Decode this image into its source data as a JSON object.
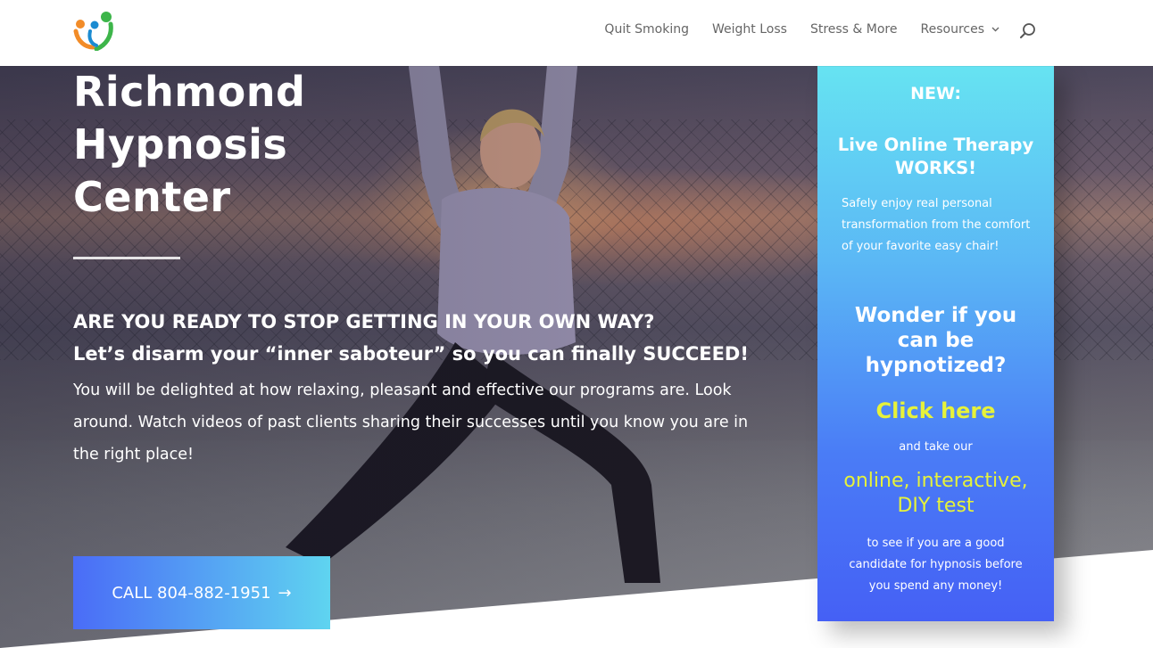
{
  "header": {
    "nav": [
      {
        "label": "Quit Smoking"
      },
      {
        "label": "Weight Loss"
      },
      {
        "label": "Stress & More"
      },
      {
        "label": "Resources"
      }
    ]
  },
  "hero": {
    "title_line1": "Richmond",
    "title_line2": "Hypnosis",
    "title_line3": "Center",
    "headline": "ARE YOU READY TO STOP GETTING IN YOUR OWN WAY?",
    "subhead": "Let’s disarm your “inner saboteur” so you can finally SUCCEED!",
    "body": "You will be delighted at how relaxing, pleasant and effective our programs are. Look around.  Watch videos of past clients sharing their successes until you know you are in the right place!",
    "cta_label": "CALL 804-882-1951",
    "cta_arrow": "→"
  },
  "promo": {
    "new": "NEW:",
    "live_online": "Live Online Therapy WORKS!",
    "description": "Safely enjoy real personal transformation from the comfort of your favorite easy chair!",
    "wonder": "Wonder if you can be hypnotized?",
    "click_here": "Click here",
    "take_our": "and take our",
    "online_test": "online, interactive, DIY test",
    "see_if": "to see if you are a good candidate for hypnosis before you spend any money!"
  },
  "colors": {
    "cta_gradient_start": "#4a6cf7",
    "cta_gradient_end": "#5fd4f0",
    "promo_top": "#66e3f2",
    "promo_bottom": "#4560f5",
    "promo_highlight": "#e6f23a",
    "nav_text": "#666666"
  },
  "icons": {
    "logo": "people-logo-icon",
    "search": "search-icon",
    "dropdown": "chevron-down-icon",
    "cta_arrow": "arrow-right-icon"
  }
}
